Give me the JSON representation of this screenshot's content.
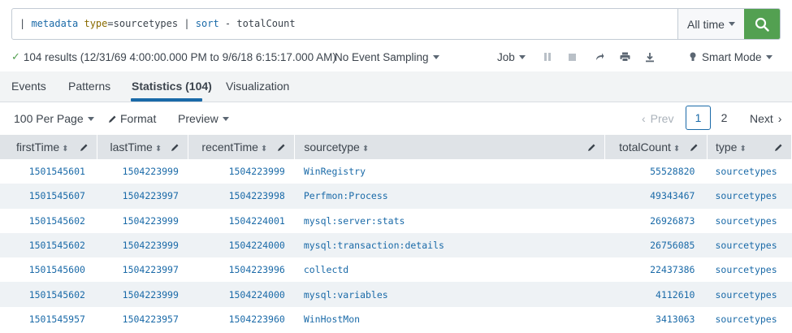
{
  "search": {
    "query_tokens": [
      {
        "text": "| ",
        "kind": "pipe"
      },
      {
        "text": "metadata",
        "kind": "cmd"
      },
      {
        "text": " ",
        "kind": "plain"
      },
      {
        "text": "type",
        "kind": "arg"
      },
      {
        "text": "=sourcetypes ",
        "kind": "plain"
      },
      {
        "text": "| ",
        "kind": "pipe"
      },
      {
        "text": "sort",
        "kind": "cmd"
      },
      {
        "text": " - totalCount",
        "kind": "plain"
      }
    ],
    "time_range": "All time",
    "submit_icon": "search-icon",
    "accent_color": "#53a051"
  },
  "status": {
    "results_text": "104 results (12/31/69 4:00:00.000 PM to 9/6/18 6:15:17.000 AM)",
    "sampling": "No Event Sampling",
    "job": "Job",
    "mode": "Smart Mode",
    "icons": [
      "pause-icon",
      "stop-icon",
      "share-icon",
      "print-icon",
      "export-icon",
      "lightbulb-icon"
    ]
  },
  "tabs": [
    {
      "label": "Events"
    },
    {
      "label": "Patterns"
    },
    {
      "label": "Statistics (104)",
      "active": true
    },
    {
      "label": "Visualization"
    }
  ],
  "controls": {
    "per_page": "100 Per Page",
    "format": "Format",
    "preview": "Preview",
    "prev": "Prev",
    "next": "Next",
    "pages": [
      "1",
      "2"
    ],
    "current_page": "1"
  },
  "table": {
    "columns": [
      "firstTime",
      "lastTime",
      "recentTime",
      "sourcetype",
      "totalCount",
      "type"
    ],
    "rows": [
      [
        "1501545601",
        "1504223999",
        "1504223999",
        "WinRegistry",
        "55528820",
        "sourcetypes"
      ],
      [
        "1501545607",
        "1504223997",
        "1504223998",
        "Perfmon:Process",
        "49343467",
        "sourcetypes"
      ],
      [
        "1501545602",
        "1504223999",
        "1504224001",
        "mysql:server:stats",
        "26926873",
        "sourcetypes"
      ],
      [
        "1501545602",
        "1504223999",
        "1504224000",
        "mysql:transaction:details",
        "26756085",
        "sourcetypes"
      ],
      [
        "1501545600",
        "1504223997",
        "1504223996",
        "collectd",
        "22437386",
        "sourcetypes"
      ],
      [
        "1501545602",
        "1504223999",
        "1504224000",
        "mysql:variables",
        "4112610",
        "sourcetypes"
      ],
      [
        "1501545957",
        "1504223957",
        "1504223960",
        "WinHostMon",
        "3413063",
        "sourcetypes"
      ]
    ]
  },
  "colors": {
    "link_blue": "#1a6aa8",
    "header_bg": "#dfe3e7",
    "stripe_bg": "#eef2f5"
  }
}
